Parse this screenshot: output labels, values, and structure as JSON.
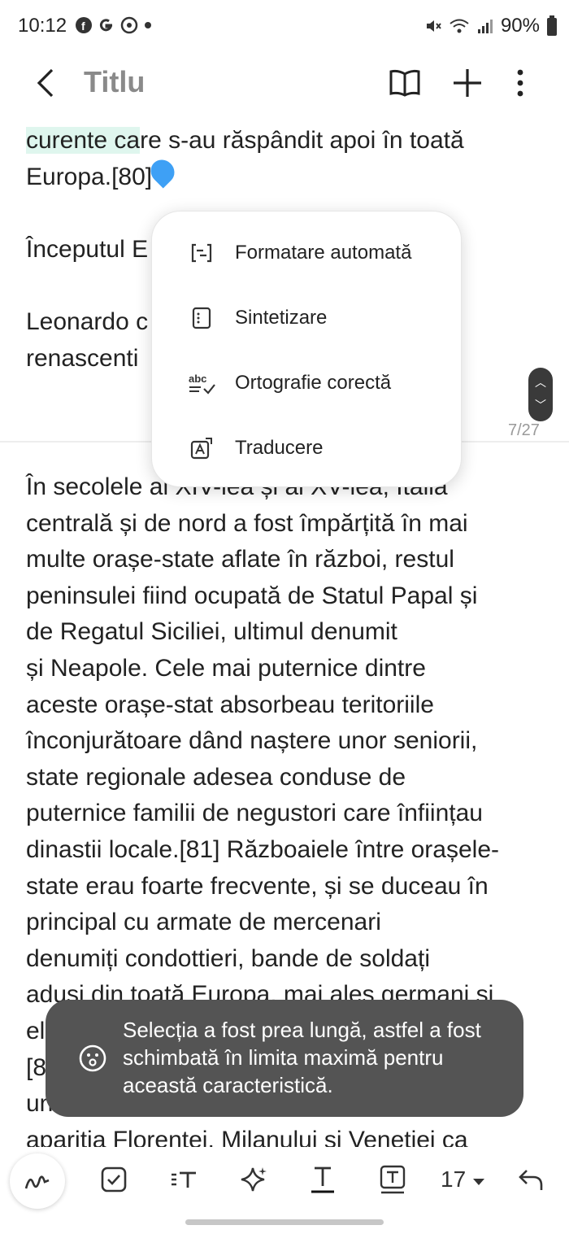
{
  "status_bar": {
    "time": "10:12",
    "battery": "90%",
    "icons": [
      "facebook-icon",
      "google-icon",
      "app-icon",
      "dot-icon",
      "mute-icon",
      "wifi-icon",
      "signal-icon",
      "battery-icon"
    ]
  },
  "toolbar": {
    "title": "Titlu",
    "icons": [
      "back-icon",
      "reading-mode-icon",
      "add-icon",
      "more-icon"
    ]
  },
  "note_top": {
    "line1_highlighted": "curente ca",
    "line1_rest": "re s-au răspândit apoi în toată",
    "line2": "Europa.[80]",
    "line3": "Începutul E",
    "line4": "Leonardo c",
    "line5": "renascenti"
  },
  "pager": "7/27",
  "menu": {
    "items": [
      {
        "label": "Formatare automată",
        "icon": "auto-format-icon"
      },
      {
        "label": "Sintetizare",
        "icon": "summarize-icon"
      },
      {
        "label": "Ortografie corectă",
        "icon": "spell-check-icon"
      },
      {
        "label": "Traducere",
        "icon": "translate-icon"
      }
    ]
  },
  "note_body": [
    "În secolele al XIV-lea și al XV-lea, Italia",
    "centrală și de nord a fost împărțită în mai",
    "multe orașe-state aflate în război, restul",
    "peninsulei fiind ocupată de Statul Papal și",
    "de Regatul Siciliei, ultimul denumit",
    "și Neapole. Cele mai puternice dintre",
    "aceste orașe-stat absorbeau teritoriile",
    "înconjurătoare dând naștere unor seniorii,",
    "state regionale adesea conduse de",
    "puternice familii de negustori care înființau",
    "dinastii locale.[81] Războaiele între orașele-",
    "state erau foarte frecvente, și se duceau în",
    "principal cu armate de mercenari",
    "denumiți condottieri, bande de soldați",
    "aduși din toată Europa, mai ales germani și",
    "el",
    "[8",
    "un",
    "apariția Florenței, Milanului și Veneției ca"
  ],
  "toast": {
    "text": "Selecția a fost prea lungă, astfel a fost schimbată în limita maximă pentru această caracteristică.",
    "icon": "info-icon"
  },
  "bottom_bar": {
    "font_size": "17",
    "icons": [
      "pen-icon",
      "checkbox-icon",
      "text-style-icon",
      "ai-sparkle-icon",
      "underline-icon",
      "text-box-icon",
      "dropdown-icon",
      "undo-icon"
    ]
  }
}
